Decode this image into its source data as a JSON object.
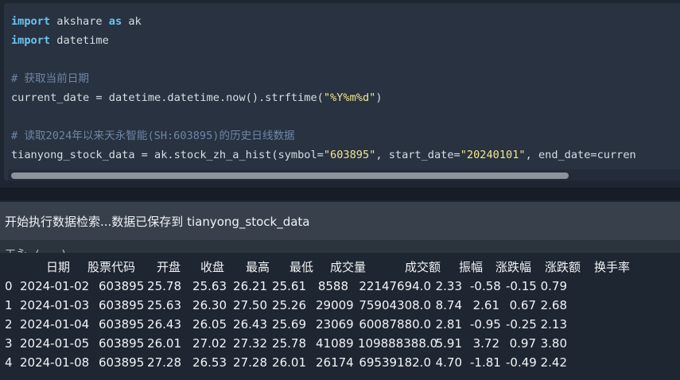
{
  "code_cell": {
    "lines": [
      [
        {
          "t": "import",
          "c": "kw"
        },
        {
          "t": " akshare ",
          "c": ""
        },
        {
          "t": "as",
          "c": "kw"
        },
        {
          "t": " ak",
          "c": ""
        }
      ],
      [
        {
          "t": "import",
          "c": "kw"
        },
        {
          "t": " datetime",
          "c": ""
        }
      ],
      [],
      [
        {
          "t": "# 获取当前日期",
          "c": "cm"
        }
      ],
      [
        {
          "t": "current_date = datetime.datetime.now().strftime(",
          "c": ""
        },
        {
          "t": "\"%Y%m%d\"",
          "c": "st"
        },
        {
          "t": ")",
          "c": ""
        }
      ],
      [],
      [
        {
          "t": "# 读取2024年以来天永智能(SH:603895)的历史日线数据",
          "c": "cm"
        }
      ],
      [
        {
          "t": "tianyong_stock_data = ak.stock_zh_a_hist(symbol=",
          "c": ""
        },
        {
          "t": "\"603895\"",
          "c": "st"
        },
        {
          "t": ", start_date=",
          "c": ""
        },
        {
          "t": "\"20240101\"",
          "c": "st"
        },
        {
          "t": ", end_date=curren",
          "c": ""
        }
      ]
    ]
  },
  "status": {
    "message": "开始执行数据检索...数据已保存到 tianyong_stock_data",
    "partial_line": "天永 (...)"
  },
  "dataframe": {
    "columns": [
      "日期",
      "股票代码",
      "开盘",
      "收盘",
      "最高",
      "最低",
      "成交量",
      "成交额",
      "振幅",
      "涨跌幅",
      "涨跌额",
      "换手率"
    ],
    "rows": [
      [
        "0",
        "2024-01-02",
        "603895",
        "25.78",
        "25.63",
        "26.21",
        "25.61",
        "8588",
        "22147694.0",
        "2.33",
        "-0.58",
        "-0.15",
        "0.79"
      ],
      [
        "1",
        "2024-01-03",
        "603895",
        "25.63",
        "26.30",
        "27.50",
        "25.26",
        "29009",
        "75904308.0",
        "8.74",
        "2.61",
        "0.67",
        "2.68"
      ],
      [
        "2",
        "2024-01-04",
        "603895",
        "26.43",
        "26.05",
        "26.43",
        "25.69",
        "23069",
        "60087880.0",
        "2.81",
        "-0.95",
        "-0.25",
        "2.13"
      ],
      [
        "3",
        "2024-01-05",
        "603895",
        "26.01",
        "27.02",
        "27.32",
        "25.78",
        "41089",
        "109888388.0",
        "5.91",
        "3.72",
        "0.97",
        "3.80"
      ],
      [
        "4",
        "2024-01-08",
        "603895",
        "27.28",
        "26.53",
        "27.28",
        "26.01",
        "26174",
        "69539182.0",
        "4.70",
        "-1.81",
        "-0.49",
        "2.42"
      ]
    ]
  }
}
